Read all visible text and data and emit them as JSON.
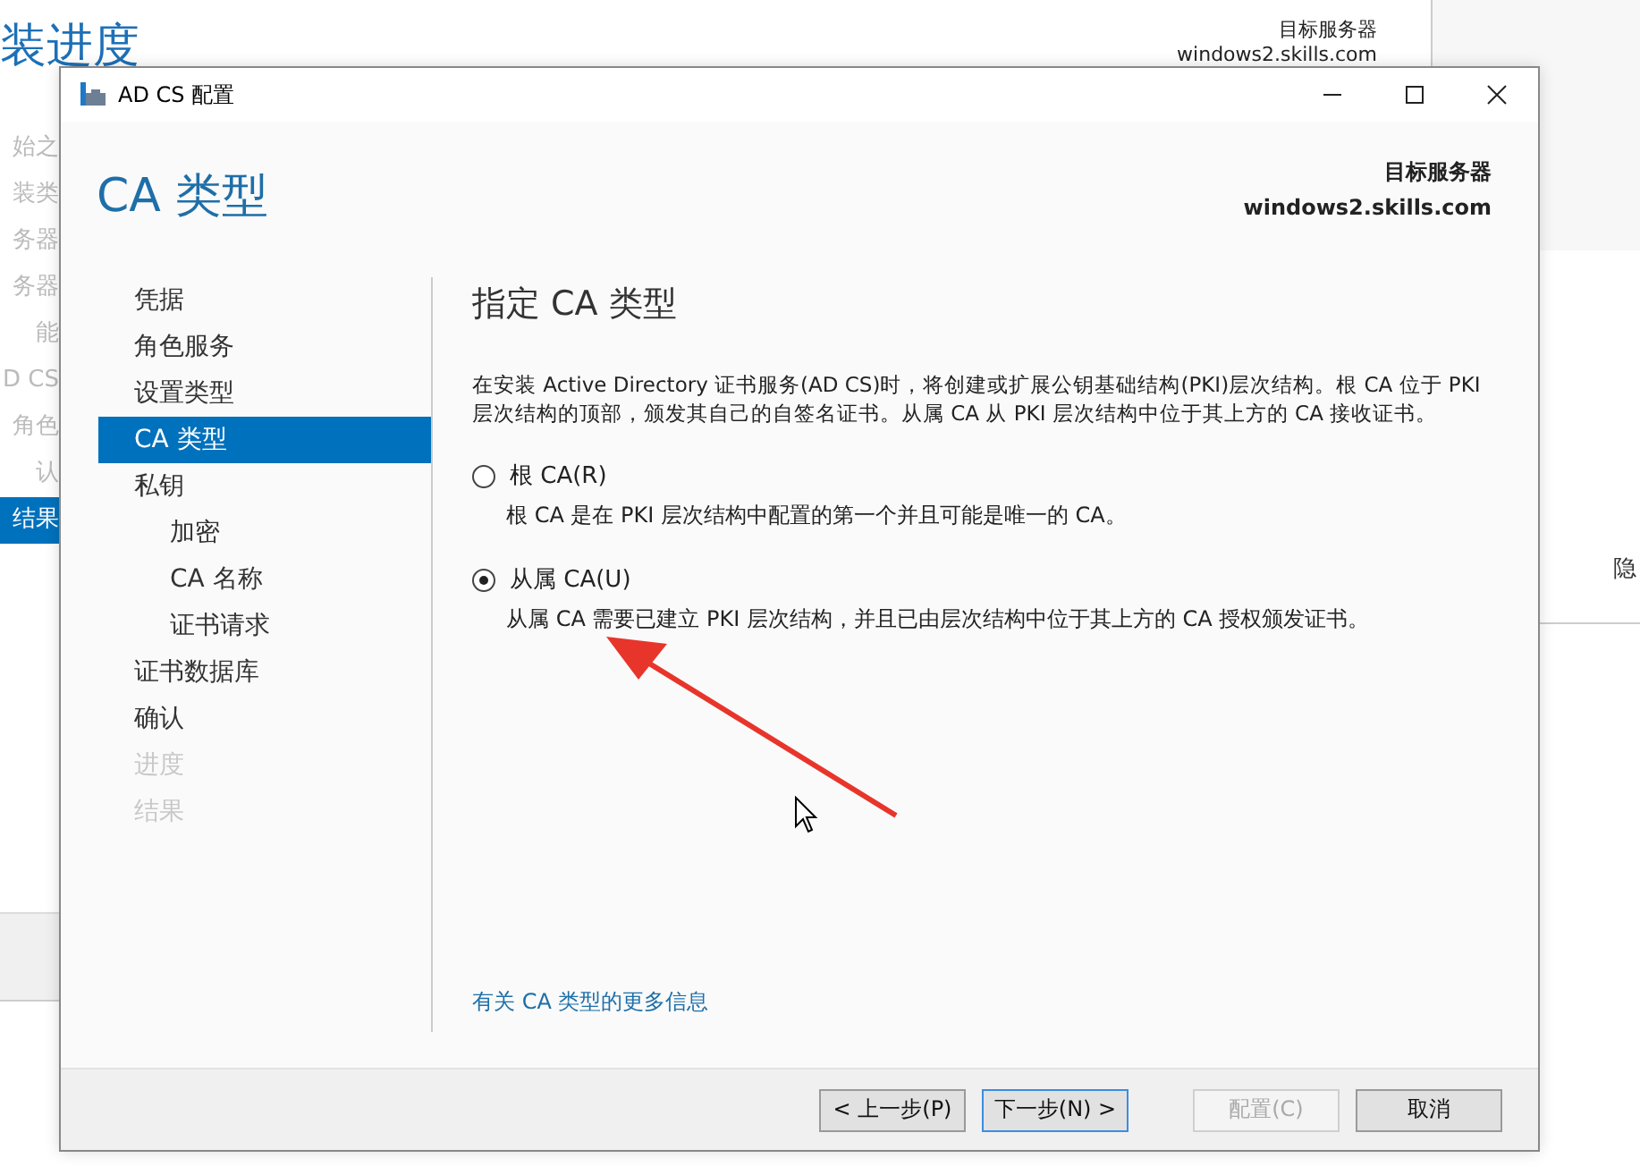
{
  "background_window": {
    "title": "装进度",
    "target_label": "目标服务器",
    "target_server": "windows2.skills.com",
    "side_text": "隐",
    "steps": [
      {
        "label": "始之",
        "selected": false
      },
      {
        "label": "装类",
        "selected": false
      },
      {
        "label": "务器",
        "selected": false
      },
      {
        "label": "务器",
        "selected": false
      },
      {
        "label": "能",
        "selected": false
      },
      {
        "label": "D CS",
        "selected": false
      },
      {
        "label": "角色",
        "selected": false
      },
      {
        "label": "认",
        "selected": false
      },
      {
        "label": "结果",
        "selected": true
      }
    ]
  },
  "dialog": {
    "title": "AD CS 配置",
    "page_title": "CA 类型",
    "target_label": "目标服务器",
    "target_server": "windows2.skills.com",
    "nav": [
      {
        "label": "凭据",
        "selected": false,
        "disabled": false
      },
      {
        "label": "角色服务",
        "selected": false,
        "disabled": false
      },
      {
        "label": "设置类型",
        "selected": false,
        "disabled": false
      },
      {
        "label": "CA 类型",
        "selected": true,
        "disabled": false
      },
      {
        "label": "私钥",
        "selected": false,
        "disabled": false,
        "children": [
          {
            "label": "加密",
            "selected": false,
            "disabled": false
          },
          {
            "label": "CA 名称",
            "selected": false,
            "disabled": false
          },
          {
            "label": "证书请求",
            "selected": false,
            "disabled": false
          }
        ]
      },
      {
        "label": "证书数据库",
        "selected": false,
        "disabled": false
      },
      {
        "label": "确认",
        "selected": false,
        "disabled": false
      },
      {
        "label": "进度",
        "selected": false,
        "disabled": true
      },
      {
        "label": "结果",
        "selected": false,
        "disabled": true
      }
    ],
    "heading": "指定 CA 类型",
    "description": "在安装 Active Directory 证书服务(AD CS)时，将创建或扩展公钥基础结构(PKI)层次结构。根 CA 位于 PKI 层次结构的顶部，颁发其自己的自签名证书。从属 CA 从 PKI 层次结构中位于其上方的 CA 接收证书。",
    "options": [
      {
        "label": "根 CA(R)",
        "selected": false,
        "description": "根 CA 是在 PKI 层次结构中配置的第一个并且可能是唯一的 CA。"
      },
      {
        "label": "从属 CA(U)",
        "selected": true,
        "description": "从属 CA 需要已建立 PKI 层次结构，并且已由层次结构中位于其上方的 CA 授权颁发证书。"
      }
    ],
    "more_info_link": "有关 CA 类型的更多信息",
    "buttons": [
      {
        "label": "< 上一步(P)",
        "default": false,
        "disabled": false
      },
      {
        "label": "下一步(N) >",
        "default": true,
        "disabled": false
      },
      {
        "label": "配置(C)",
        "default": false,
        "disabled": true
      },
      {
        "label": "取消",
        "default": false,
        "disabled": false
      }
    ]
  }
}
